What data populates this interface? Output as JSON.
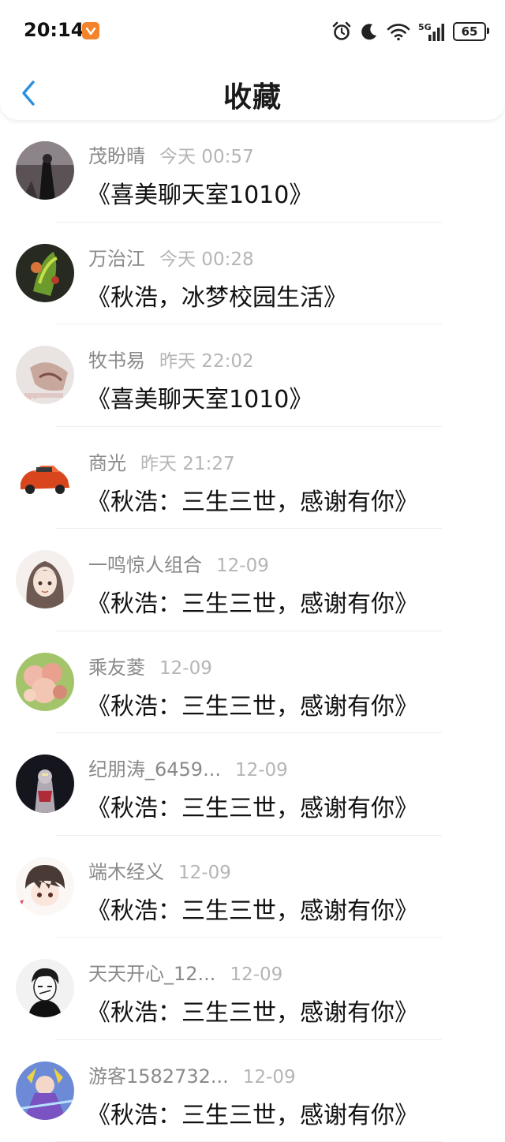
{
  "status_bar": {
    "time": "20:14",
    "battery": "65",
    "network": "5G",
    "icons": [
      "alarm-icon",
      "moon-icon",
      "wifi-icon",
      "signal-icon",
      "battery-icon"
    ]
  },
  "header": {
    "title": "收藏",
    "back_icon": "chevron-left-icon",
    "accent_color": "#2a8fe0"
  },
  "favorites": [
    {
      "user": "茂盼晴",
      "time": "今天 00:57",
      "room": "《喜美聊天室1010》"
    },
    {
      "user": "万治江",
      "time": "今天 00:28",
      "room": "《秋浩，冰梦校园生活》"
    },
    {
      "user": "牧书易",
      "time": "昨天 22:02",
      "room": "《喜美聊天室1010》"
    },
    {
      "user": "商光",
      "time": "昨天 21:27",
      "room": "《秋浩：三生三世，感谢有你》"
    },
    {
      "user": "一鸣惊人组合",
      "time": "12-09",
      "room": "《秋浩：三生三世，感谢有你》"
    },
    {
      "user": "乘友菱",
      "time": "12-09",
      "room": "《秋浩：三生三世，感谢有你》"
    },
    {
      "user": "纪朋涛_6459...",
      "time": "12-09",
      "room": "《秋浩：三生三世，感谢有你》"
    },
    {
      "user": "端木经义",
      "time": "12-09",
      "room": "《秋浩：三生三世，感谢有你》"
    },
    {
      "user": "天天开心_12...",
      "time": "12-09",
      "room": "《秋浩：三生三世，感谢有你》"
    },
    {
      "user": "游客1582732...",
      "time": "12-09",
      "room": "《秋浩：三生三世，感谢有你》"
    }
  ]
}
